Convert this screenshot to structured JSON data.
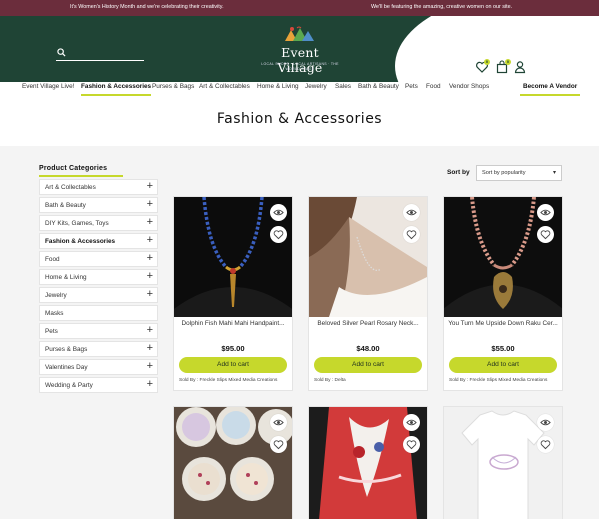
{
  "announcement": {
    "left": "It's Women's History Month and we're celebrating their creativity.",
    "right": "We'll be featuring the amazing, creative women on our site."
  },
  "header": {
    "logo_name": "Event Village",
    "logo_tagline": "LOCAL SHOPS · LOCAL ARTISANS · THE WORLD STAGE",
    "search": {
      "placeholder": "",
      "value": ""
    },
    "wishlist_count": "0",
    "cart_count": "0"
  },
  "nav": {
    "items": [
      "Event Village Live!",
      "Fashion & Accessories",
      "Purses & Bags",
      "Art & Collectables",
      "Home & Living",
      "Jewelry",
      "Sales",
      "Bath & Beauty",
      "Pets",
      "Food",
      "Vendor Shops"
    ],
    "active": "Fashion & Accessories",
    "vendor_label": "Become A Vendor"
  },
  "page_title": "Fashion & Accessories",
  "sidebar": {
    "title": "Product Categories",
    "categories": [
      {
        "label": "Art & Collectables",
        "expandable": true
      },
      {
        "label": "Bath & Beauty",
        "expandable": true
      },
      {
        "label": "DIY Kits, Games, Toys",
        "expandable": true
      },
      {
        "label": "Fashion & Accessories",
        "expandable": true,
        "active": true
      },
      {
        "label": "Food",
        "expandable": true
      },
      {
        "label": "Home & Living",
        "expandable": true
      },
      {
        "label": "Jewelry",
        "expandable": true
      },
      {
        "label": "Masks",
        "expandable": false
      },
      {
        "label": "Pets",
        "expandable": true
      },
      {
        "label": "Purses & Bags",
        "expandable": true
      },
      {
        "label": "Valentines Day",
        "expandable": true
      },
      {
        "label": "Wedding & Party",
        "expandable": true
      }
    ],
    "plus_glyph": "+"
  },
  "sort": {
    "label": "Sort by",
    "selected": "Sort by popularity"
  },
  "products": [
    {
      "name": "Dolphin Fish Mahi Mahi Handpaint...",
      "price": "$95.00",
      "button": "Add to cart",
      "sold_by": "Sold By : Freckle Slips Mixed Media Creations"
    },
    {
      "name": "Beloved Silver Pearl Rosary Neck...",
      "price": "$48.00",
      "button": "Add to cart",
      "sold_by": "Sold By : Delta"
    },
    {
      "name": "You Turn Me Upside Down Raku Cer...",
      "price": "$55.00",
      "button": "Add to cart",
      "sold_by": "Sold By : Freckle Slips Mixed Media Creations"
    }
  ],
  "icons": {
    "search": "search-icon",
    "wishlist": "heart-icon",
    "cart": "bag-icon",
    "account": "user-icon",
    "quick_view": "eye-icon"
  },
  "colors": {
    "maroon": "#6b2d3c",
    "forest": "#1f4435",
    "accent": "#c6d82c",
    "background": "#f4f4f4"
  }
}
